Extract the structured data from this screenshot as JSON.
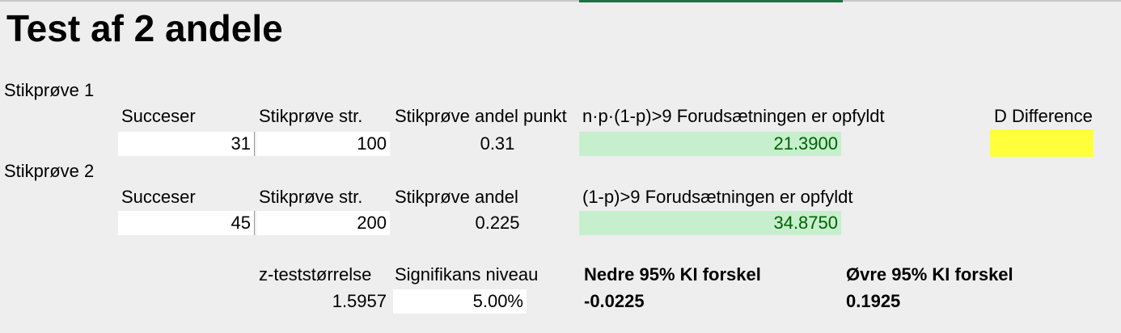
{
  "title": "Test af 2 andele",
  "sample1": {
    "heading": "Stikprøve 1",
    "successes_label": "Succeser",
    "size_label": "Stikprøve str.",
    "proportion_label": "Stikprøve andel punkt",
    "condition_label": "n·p·(1-p)>9 Forudsætningen er opfyldt",
    "difference_label": "D Difference",
    "successes": "31",
    "size": "100",
    "proportion": "0.31",
    "condition_value": "21.3900",
    "difference_value": ""
  },
  "sample2": {
    "heading": "Stikprøve 2",
    "successes_label": "Succeser",
    "size_label": "Stikprøve str.",
    "proportion_label": "Stikprøve andel",
    "condition_label": "(1-p)>9 Forudsætningen er opfyldt",
    "successes": "45",
    "size": "200",
    "proportion": "0.225",
    "condition_value": "34.8750"
  },
  "results": {
    "z_label": "z-teststørrelse",
    "z_value": "1.5957",
    "significance_label": "Signifikans niveau",
    "significance_value": "5.00%",
    "lower_ci_label": "Nedre 95% KI forskel",
    "lower_ci_value": "-0.0225",
    "upper_ci_label": "Øvre 95% KI forskel",
    "upper_ci_value": "0.1925"
  },
  "colors": {
    "background": "#eeeeee",
    "input_cell": "#ffffff",
    "ok_cell_fill": "#c6efce",
    "ok_cell_text": "#006100",
    "highlight_cell": "#ffff3c",
    "active_column_accent": "#1e7145"
  }
}
